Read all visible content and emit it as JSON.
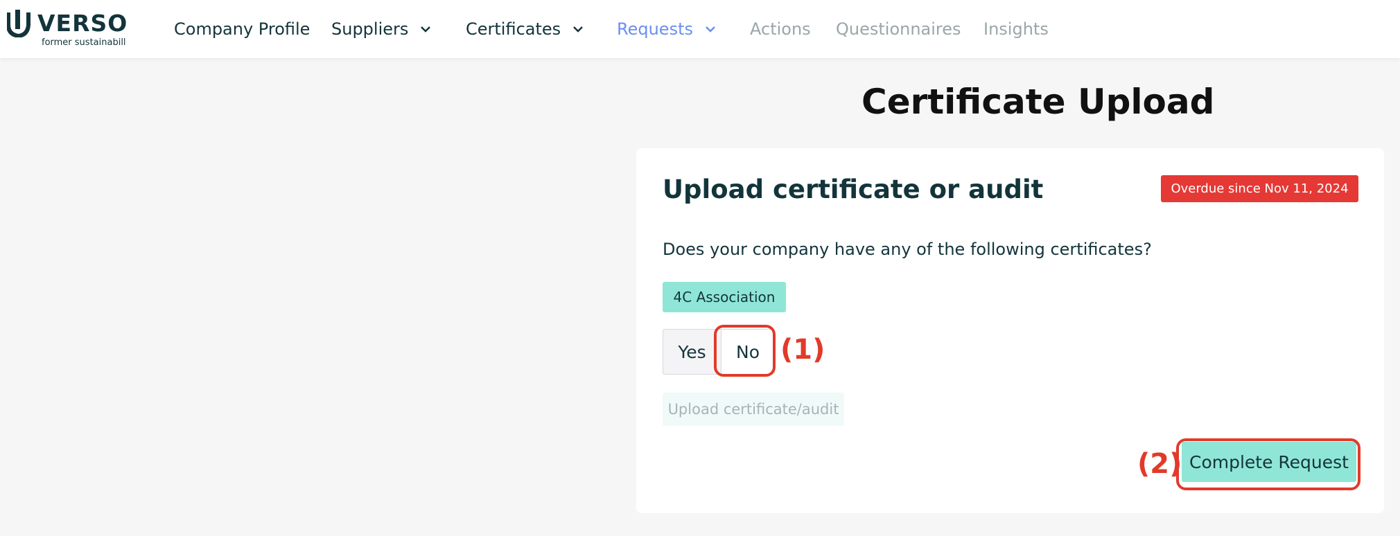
{
  "header": {
    "logo_word": "VERSO",
    "logo_sub": "former sustainabill",
    "nav": [
      {
        "label": "Company Profile"
      },
      {
        "label": "Suppliers"
      },
      {
        "label": "Certificates"
      },
      {
        "label": "Requests"
      },
      {
        "label": "Actions"
      },
      {
        "label": "Questionnaires"
      },
      {
        "label": "Insights"
      }
    ]
  },
  "main": {
    "page_title": "Certificate Upload",
    "card": {
      "title": "Upload certificate or audit",
      "overdue_badge": "Overdue since Nov 11, 2024",
      "question": "Does your company have any of the following certificates?",
      "certificate_tag": "4C Association",
      "options": {
        "yes": "Yes",
        "no": "No"
      },
      "upload_button": "Upload certificate/audit",
      "complete_button": "Complete Request"
    }
  },
  "annotations": {
    "step1": "(1)",
    "step2": "(2)"
  },
  "colors": {
    "accent_teal": "#8fe6d6",
    "nav_active": "#6b8ef0",
    "badge_red": "#e53935",
    "annotation_red": "#e23a2a",
    "text_dark": "#13343b"
  }
}
